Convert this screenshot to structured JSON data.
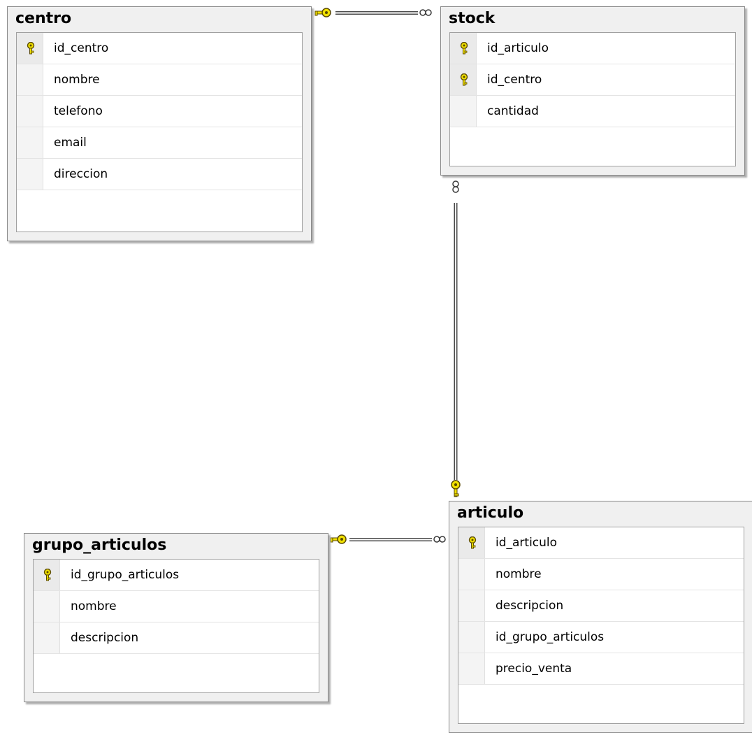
{
  "tables": {
    "centro": {
      "name": "centro",
      "columns": [
        {
          "name": "id_centro",
          "pk": true
        },
        {
          "name": "nombre",
          "pk": false
        },
        {
          "name": "telefono",
          "pk": false
        },
        {
          "name": "email",
          "pk": false
        },
        {
          "name": "direccion",
          "pk": false
        }
      ]
    },
    "stock": {
      "name": "stock",
      "columns": [
        {
          "name": "id_articulo",
          "pk": true
        },
        {
          "name": "id_centro",
          "pk": true
        },
        {
          "name": "cantidad",
          "pk": false
        }
      ]
    },
    "articulo": {
      "name": "articulo",
      "columns": [
        {
          "name": "id_articulo",
          "pk": true
        },
        {
          "name": "nombre",
          "pk": false
        },
        {
          "name": "descripcion",
          "pk": false
        },
        {
          "name": "id_grupo_articulos",
          "pk": false
        },
        {
          "name": "precio_venta",
          "pk": false
        }
      ]
    },
    "grupo_articulos": {
      "name": "grupo_articulos",
      "columns": [
        {
          "name": "id_grupo_articulos",
          "pk": true
        },
        {
          "name": "nombre",
          "pk": false
        },
        {
          "name": "descripcion",
          "pk": false
        }
      ]
    }
  },
  "relationships": [
    {
      "from": "centro",
      "to": "stock",
      "one_end": "key-icon",
      "many_end": "infinity-icon"
    },
    {
      "from": "articulo",
      "to": "stock",
      "one_end": "key-icon",
      "many_end": "infinity-icon"
    },
    {
      "from": "grupo_articulos",
      "to": "articulo",
      "one_end": "key-icon",
      "many_end": "infinity-icon"
    }
  ],
  "colors": {
    "key": "#f0e000",
    "key_outline": "#5a4a00"
  }
}
